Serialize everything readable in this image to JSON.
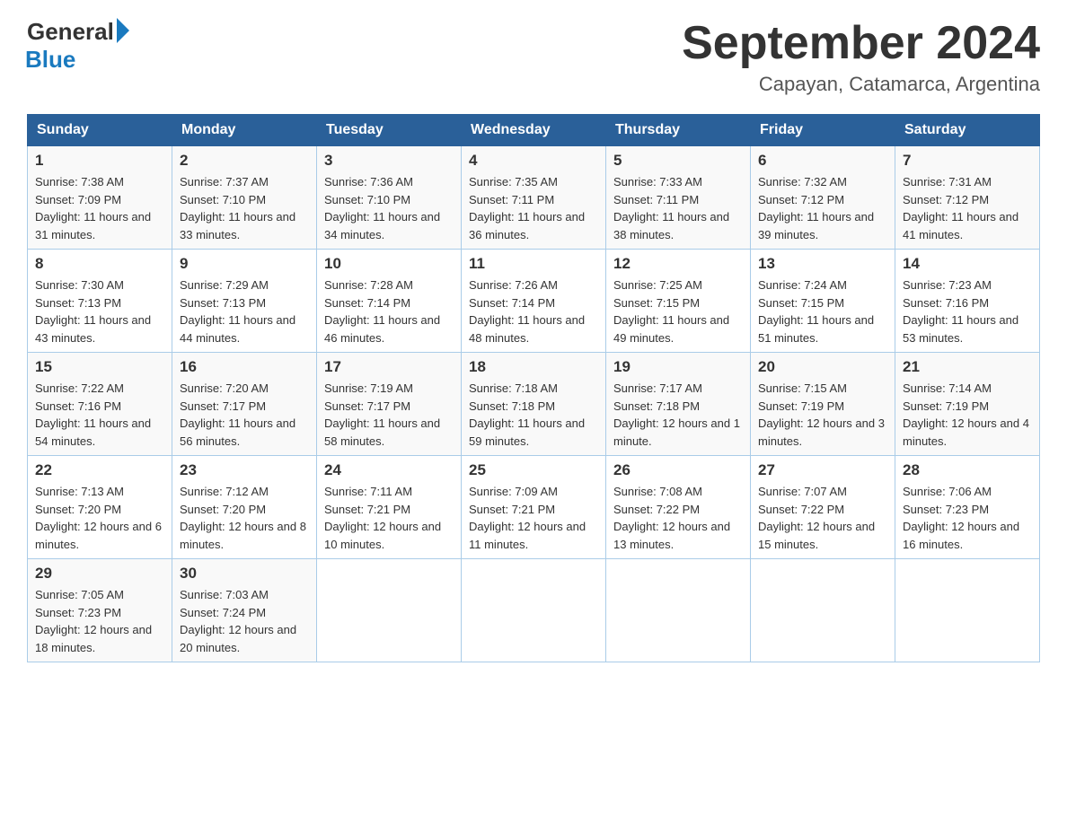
{
  "logo": {
    "general": "General",
    "blue": "Blue"
  },
  "title": "September 2024",
  "subtitle": "Capayan, Catamarca, Argentina",
  "days_of_week": [
    "Sunday",
    "Monday",
    "Tuesday",
    "Wednesday",
    "Thursday",
    "Friday",
    "Saturday"
  ],
  "weeks": [
    [
      {
        "day": "1",
        "sunrise": "7:38 AM",
        "sunset": "7:09 PM",
        "daylight": "11 hours and 31 minutes."
      },
      {
        "day": "2",
        "sunrise": "7:37 AM",
        "sunset": "7:10 PM",
        "daylight": "11 hours and 33 minutes."
      },
      {
        "day": "3",
        "sunrise": "7:36 AM",
        "sunset": "7:10 PM",
        "daylight": "11 hours and 34 minutes."
      },
      {
        "day": "4",
        "sunrise": "7:35 AM",
        "sunset": "7:11 PM",
        "daylight": "11 hours and 36 minutes."
      },
      {
        "day": "5",
        "sunrise": "7:33 AM",
        "sunset": "7:11 PM",
        "daylight": "11 hours and 38 minutes."
      },
      {
        "day": "6",
        "sunrise": "7:32 AM",
        "sunset": "7:12 PM",
        "daylight": "11 hours and 39 minutes."
      },
      {
        "day": "7",
        "sunrise": "7:31 AM",
        "sunset": "7:12 PM",
        "daylight": "11 hours and 41 minutes."
      }
    ],
    [
      {
        "day": "8",
        "sunrise": "7:30 AM",
        "sunset": "7:13 PM",
        "daylight": "11 hours and 43 minutes."
      },
      {
        "day": "9",
        "sunrise": "7:29 AM",
        "sunset": "7:13 PM",
        "daylight": "11 hours and 44 minutes."
      },
      {
        "day": "10",
        "sunrise": "7:28 AM",
        "sunset": "7:14 PM",
        "daylight": "11 hours and 46 minutes."
      },
      {
        "day": "11",
        "sunrise": "7:26 AM",
        "sunset": "7:14 PM",
        "daylight": "11 hours and 48 minutes."
      },
      {
        "day": "12",
        "sunrise": "7:25 AM",
        "sunset": "7:15 PM",
        "daylight": "11 hours and 49 minutes."
      },
      {
        "day": "13",
        "sunrise": "7:24 AM",
        "sunset": "7:15 PM",
        "daylight": "11 hours and 51 minutes."
      },
      {
        "day": "14",
        "sunrise": "7:23 AM",
        "sunset": "7:16 PM",
        "daylight": "11 hours and 53 minutes."
      }
    ],
    [
      {
        "day": "15",
        "sunrise": "7:22 AM",
        "sunset": "7:16 PM",
        "daylight": "11 hours and 54 minutes."
      },
      {
        "day": "16",
        "sunrise": "7:20 AM",
        "sunset": "7:17 PM",
        "daylight": "11 hours and 56 minutes."
      },
      {
        "day": "17",
        "sunrise": "7:19 AM",
        "sunset": "7:17 PM",
        "daylight": "11 hours and 58 minutes."
      },
      {
        "day": "18",
        "sunrise": "7:18 AM",
        "sunset": "7:18 PM",
        "daylight": "11 hours and 59 minutes."
      },
      {
        "day": "19",
        "sunrise": "7:17 AM",
        "sunset": "7:18 PM",
        "daylight": "12 hours and 1 minute."
      },
      {
        "day": "20",
        "sunrise": "7:15 AM",
        "sunset": "7:19 PM",
        "daylight": "12 hours and 3 minutes."
      },
      {
        "day": "21",
        "sunrise": "7:14 AM",
        "sunset": "7:19 PM",
        "daylight": "12 hours and 4 minutes."
      }
    ],
    [
      {
        "day": "22",
        "sunrise": "7:13 AM",
        "sunset": "7:20 PM",
        "daylight": "12 hours and 6 minutes."
      },
      {
        "day": "23",
        "sunrise": "7:12 AM",
        "sunset": "7:20 PM",
        "daylight": "12 hours and 8 minutes."
      },
      {
        "day": "24",
        "sunrise": "7:11 AM",
        "sunset": "7:21 PM",
        "daylight": "12 hours and 10 minutes."
      },
      {
        "day": "25",
        "sunrise": "7:09 AM",
        "sunset": "7:21 PM",
        "daylight": "12 hours and 11 minutes."
      },
      {
        "day": "26",
        "sunrise": "7:08 AM",
        "sunset": "7:22 PM",
        "daylight": "12 hours and 13 minutes."
      },
      {
        "day": "27",
        "sunrise": "7:07 AM",
        "sunset": "7:22 PM",
        "daylight": "12 hours and 15 minutes."
      },
      {
        "day": "28",
        "sunrise": "7:06 AM",
        "sunset": "7:23 PM",
        "daylight": "12 hours and 16 minutes."
      }
    ],
    [
      {
        "day": "29",
        "sunrise": "7:05 AM",
        "sunset": "7:23 PM",
        "daylight": "12 hours and 18 minutes."
      },
      {
        "day": "30",
        "sunrise": "7:03 AM",
        "sunset": "7:24 PM",
        "daylight": "12 hours and 20 minutes."
      },
      null,
      null,
      null,
      null,
      null
    ]
  ],
  "labels": {
    "sunrise": "Sunrise:",
    "sunset": "Sunset:",
    "daylight": "Daylight:"
  }
}
